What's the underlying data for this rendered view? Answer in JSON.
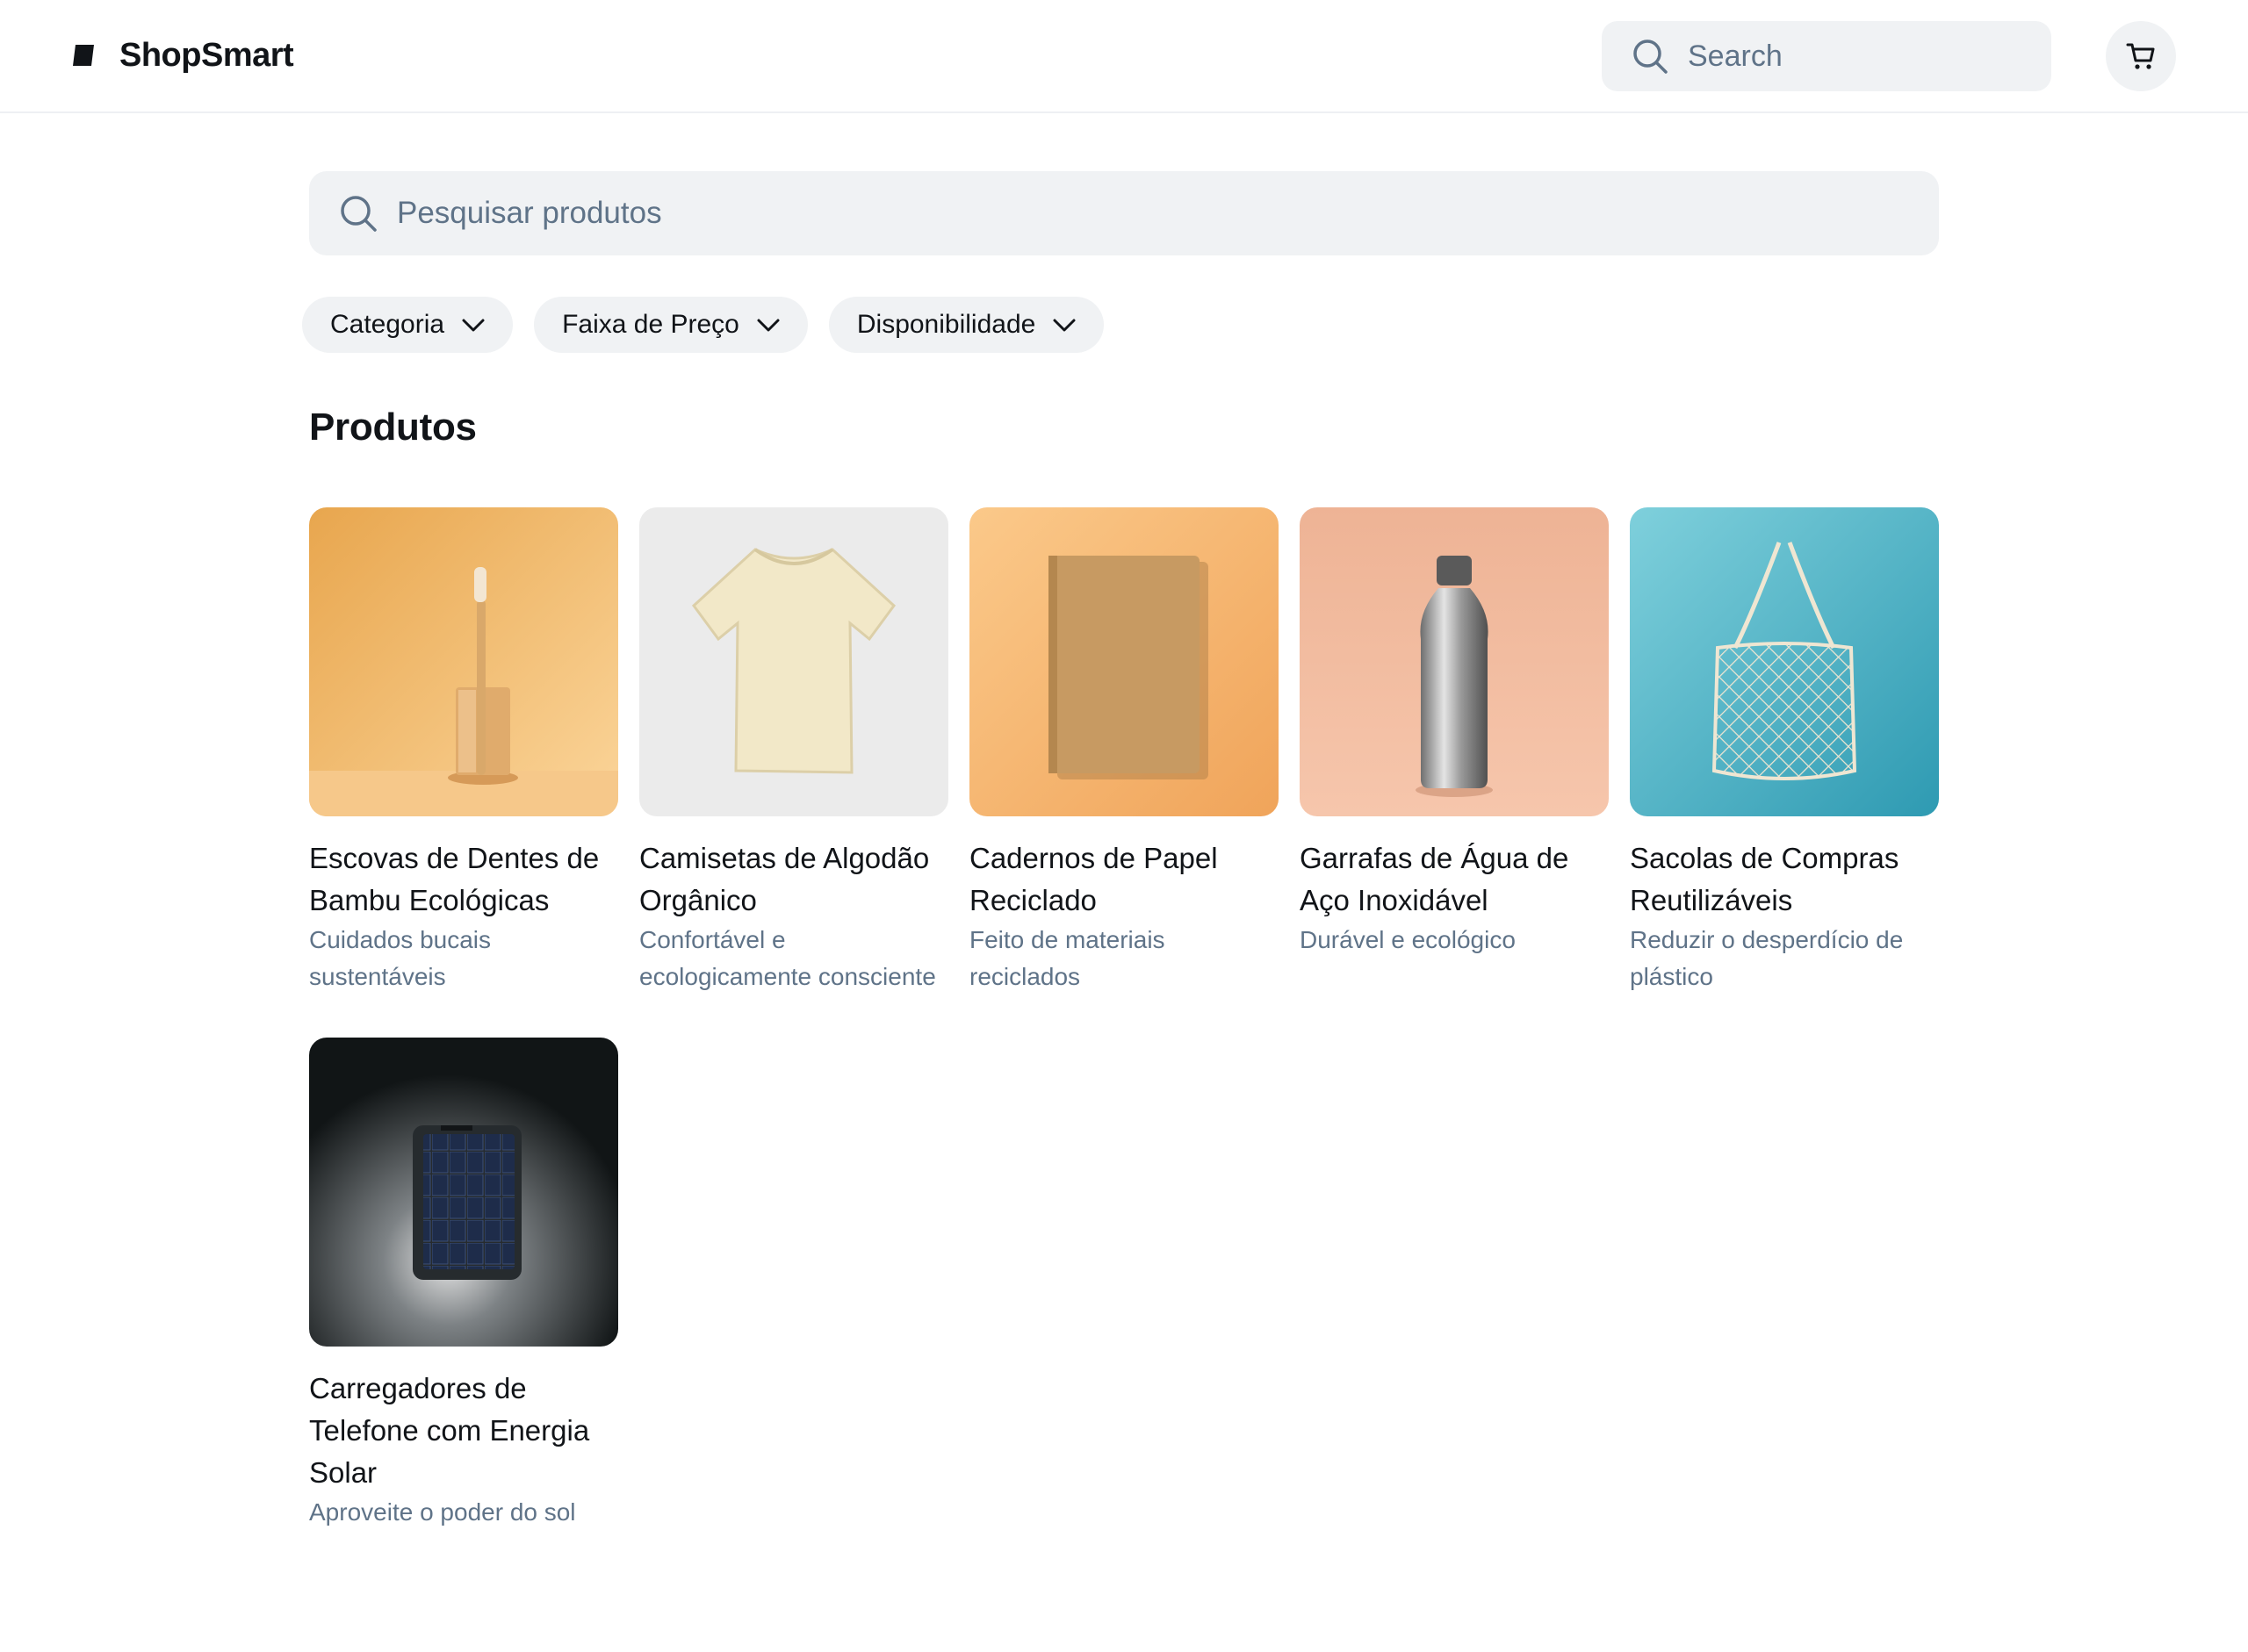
{
  "header": {
    "brand_name": "ShopSmart",
    "search_placeholder": "Search",
    "cart_icon": "cart-icon",
    "logo_icon": "shopsmart-logo-icon"
  },
  "main": {
    "search_placeholder": "Pesquisar produtos",
    "filters": [
      {
        "label": "Categoria"
      },
      {
        "label": "Faixa de Preço"
      },
      {
        "label": "Disponibilidade"
      }
    ],
    "section_title": "Produtos",
    "products": [
      {
        "title": "Escovas de Dentes de Bambu Ecológicas",
        "subtitle": "Cuidados bucais sustentáveis",
        "image": "bamboo-toothbrush"
      },
      {
        "title": "Camisetas de Algodão Orgânico",
        "subtitle": "Confortável e ecologicamente consciente",
        "image": "organic-tshirt"
      },
      {
        "title": "Cadernos de Papel Reciclado",
        "subtitle": "Feito de materiais reciclados",
        "image": "recycled-notebook"
      },
      {
        "title": "Garrafas de Água de Aço Inoxidável",
        "subtitle": "Durável e ecológico",
        "image": "steel-bottle"
      },
      {
        "title": "Sacolas de Compras Reutilizáveis",
        "subtitle": "Reduzir o desperdício de plástico",
        "image": "mesh-bag"
      },
      {
        "title": "Carregadores de Telefone com Energia Solar",
        "subtitle": "Aproveite o poder do sol",
        "image": "solar-charger"
      }
    ]
  },
  "colors": {
    "accent_bg": "#f0f2f4",
    "muted_text": "#5f7388",
    "text": "#111418"
  }
}
